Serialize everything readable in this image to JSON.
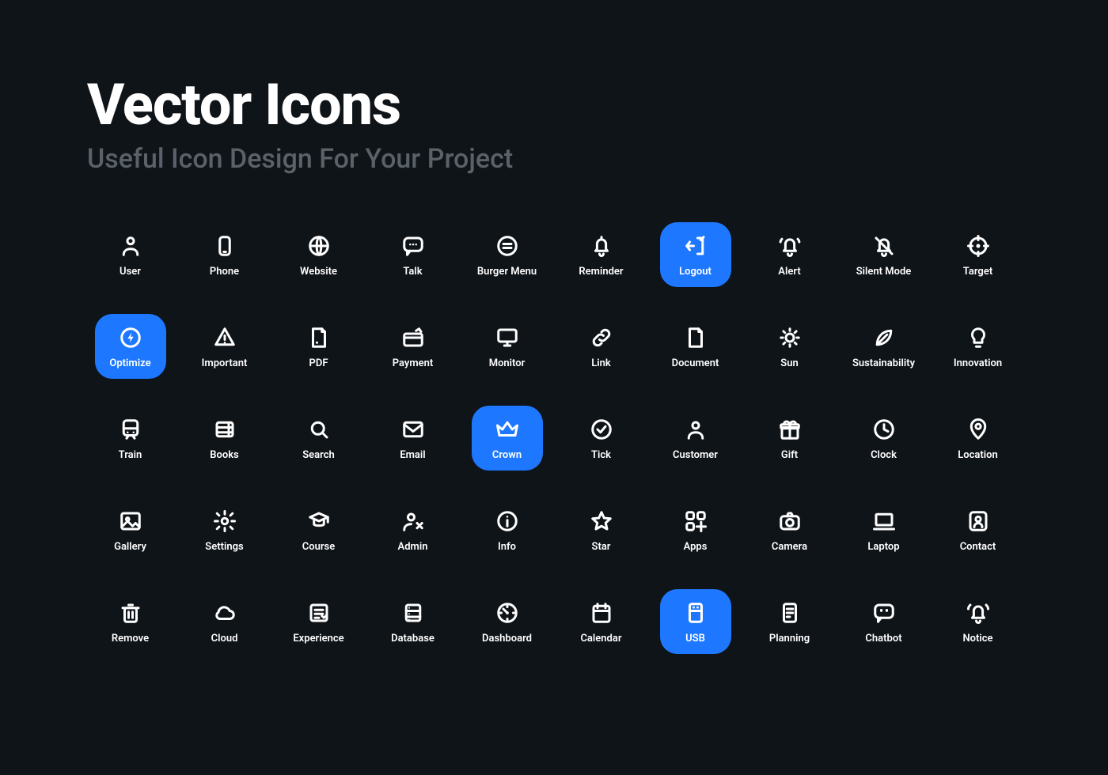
{
  "header": {
    "title": "Vector Icons",
    "subtitle": "Useful Icon Design For Your Project"
  },
  "accent": "#1e78ff",
  "icons": [
    {
      "id": "user",
      "label": "User",
      "active": false
    },
    {
      "id": "phone",
      "label": "Phone",
      "active": false
    },
    {
      "id": "website",
      "label": "Website",
      "active": false
    },
    {
      "id": "talk",
      "label": "Talk",
      "active": false
    },
    {
      "id": "burger-menu",
      "label": "Burger Menu",
      "active": false
    },
    {
      "id": "reminder",
      "label": "Reminder",
      "active": false
    },
    {
      "id": "logout",
      "label": "Logout",
      "active": true
    },
    {
      "id": "alert",
      "label": "Alert",
      "active": false
    },
    {
      "id": "silent-mode",
      "label": "Silent Mode",
      "active": false
    },
    {
      "id": "target",
      "label": "Target",
      "active": false
    },
    {
      "id": "optimize",
      "label": "Optimize",
      "active": true
    },
    {
      "id": "important",
      "label": "Important",
      "active": false
    },
    {
      "id": "pdf",
      "label": "PDF",
      "active": false
    },
    {
      "id": "payment",
      "label": "Payment",
      "active": false
    },
    {
      "id": "monitor",
      "label": "Monitor",
      "active": false
    },
    {
      "id": "link",
      "label": "Link",
      "active": false
    },
    {
      "id": "document",
      "label": "Document",
      "active": false
    },
    {
      "id": "sun",
      "label": "Sun",
      "active": false
    },
    {
      "id": "sustainability",
      "label": "Sustainability",
      "active": false
    },
    {
      "id": "innovation",
      "label": "Innovation",
      "active": false
    },
    {
      "id": "train",
      "label": "Train",
      "active": false
    },
    {
      "id": "books",
      "label": "Books",
      "active": false
    },
    {
      "id": "search",
      "label": "Search",
      "active": false
    },
    {
      "id": "email",
      "label": "Email",
      "active": false
    },
    {
      "id": "crown",
      "label": "Crown",
      "active": true
    },
    {
      "id": "tick",
      "label": "Tick",
      "active": false
    },
    {
      "id": "customer",
      "label": "Customer",
      "active": false
    },
    {
      "id": "gift",
      "label": "Gift",
      "active": false
    },
    {
      "id": "clock",
      "label": "Clock",
      "active": false
    },
    {
      "id": "location",
      "label": "Location",
      "active": false
    },
    {
      "id": "gallery",
      "label": "Gallery",
      "active": false
    },
    {
      "id": "settings",
      "label": "Settings",
      "active": false
    },
    {
      "id": "course",
      "label": "Course",
      "active": false
    },
    {
      "id": "admin",
      "label": "Admin",
      "active": false
    },
    {
      "id": "info",
      "label": "Info",
      "active": false
    },
    {
      "id": "star",
      "label": "Star",
      "active": false
    },
    {
      "id": "apps",
      "label": "Apps",
      "active": false
    },
    {
      "id": "camera",
      "label": "Camera",
      "active": false
    },
    {
      "id": "laptop",
      "label": "Laptop",
      "active": false
    },
    {
      "id": "contact",
      "label": "Contact",
      "active": false
    },
    {
      "id": "remove",
      "label": "Remove",
      "active": false
    },
    {
      "id": "cloud",
      "label": "Cloud",
      "active": false
    },
    {
      "id": "experience",
      "label": "Experience",
      "active": false
    },
    {
      "id": "database",
      "label": "Database",
      "active": false
    },
    {
      "id": "dashboard",
      "label": "Dashboard",
      "active": false
    },
    {
      "id": "calendar",
      "label": "Calendar",
      "active": false
    },
    {
      "id": "usb",
      "label": "USB",
      "active": true
    },
    {
      "id": "planning",
      "label": "Planning",
      "active": false
    },
    {
      "id": "chatbot",
      "label": "Chatbot",
      "active": false
    },
    {
      "id": "notice",
      "label": "Notice",
      "active": false
    }
  ]
}
